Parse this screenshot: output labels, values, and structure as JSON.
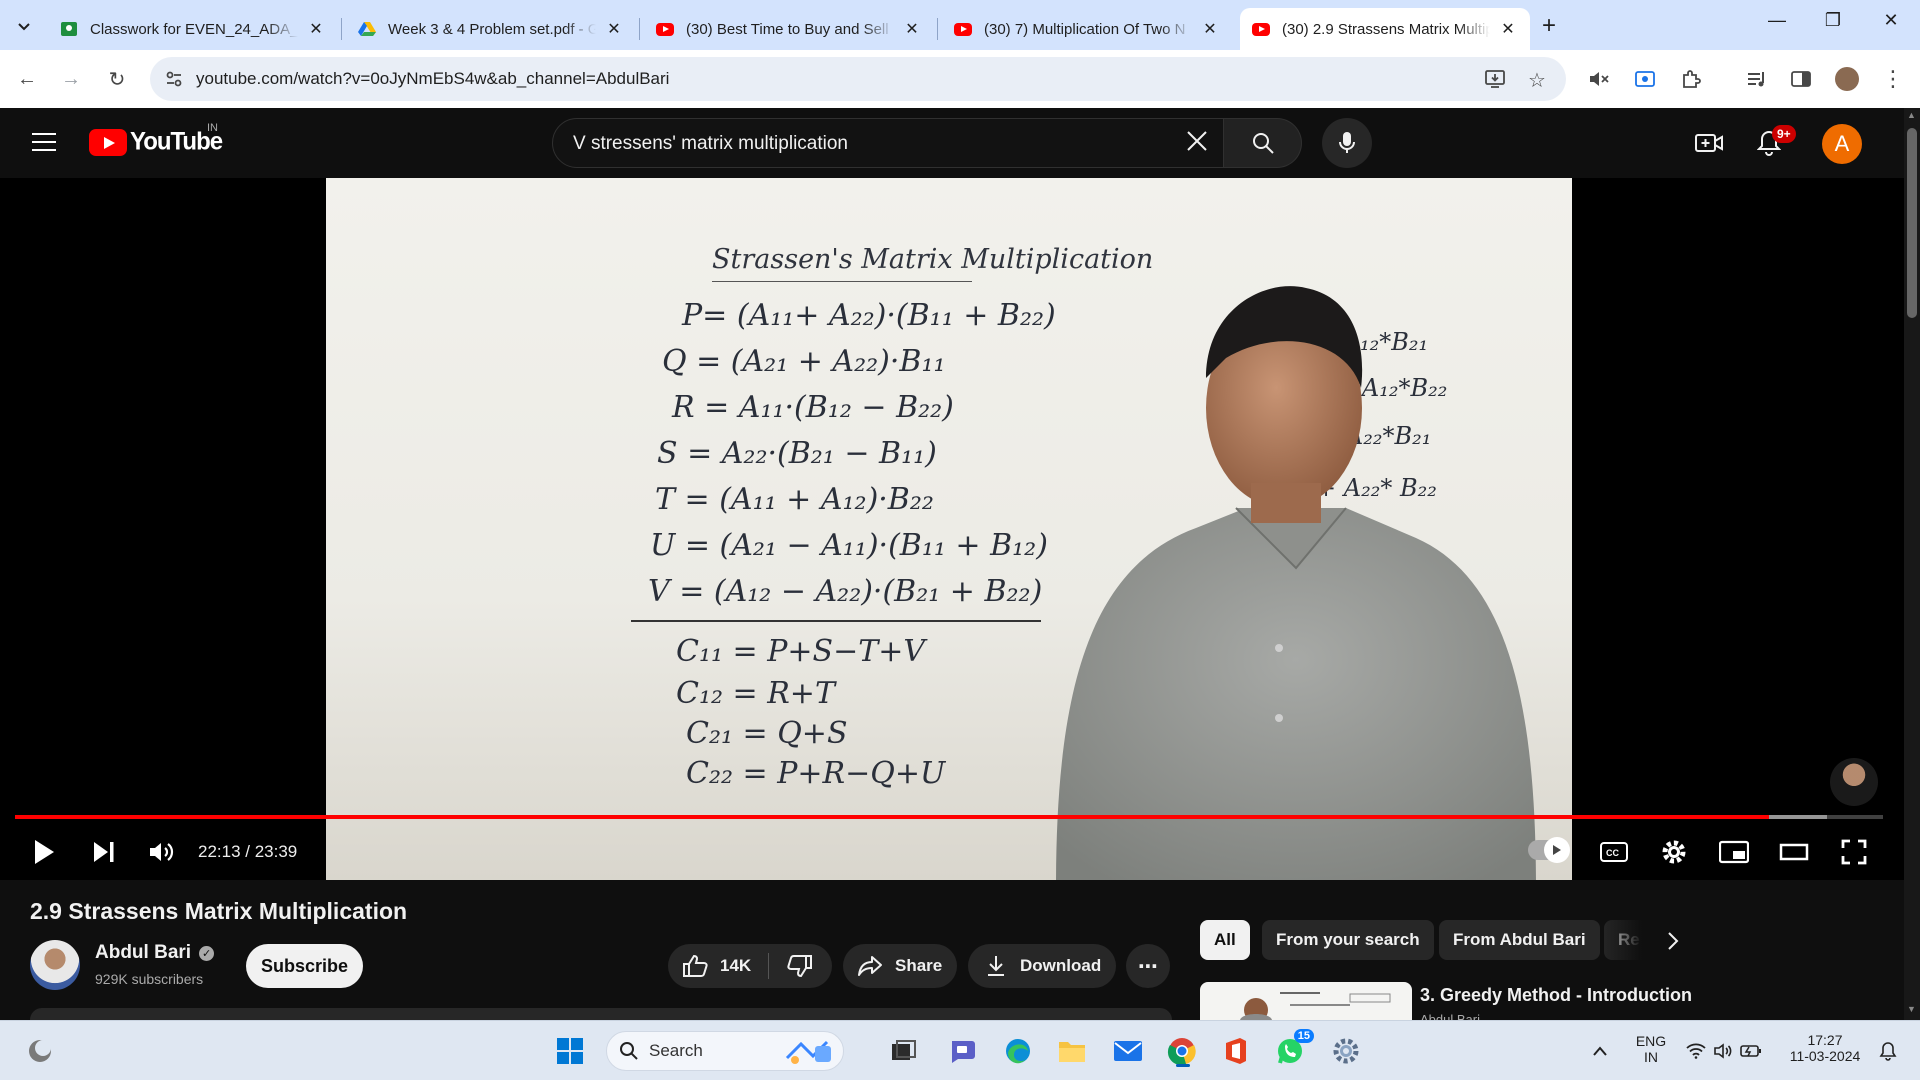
{
  "browser": {
    "tabs": [
      {
        "title": "Classwork for EVEN_24_ADA_AF",
        "favicon": "classroom-icon",
        "active": false
      },
      {
        "title": "Week 3 & 4 Problem set.pdf - G",
        "favicon": "drive-icon",
        "active": false
      },
      {
        "title": "(30) Best Time to Buy and Sell S",
        "favicon": "youtube-icon",
        "active": false
      },
      {
        "title": "(30) 7) Multiplication Of Two N",
        "favicon": "youtube-icon",
        "active": false
      },
      {
        "title": "(30) 2.9 Strassens Matrix Multip",
        "favicon": "youtube-icon",
        "active": true
      }
    ],
    "new_tab": "+",
    "url": "youtube.com/watch?v=0oJyNmEbS4w&ab_channel=AbdulBari"
  },
  "youtube": {
    "logo_text": "YouTube",
    "country": "IN",
    "search_query": "V stressens'  matrix multiplication",
    "notifications_badge": "9+",
    "account_initial": "A"
  },
  "player": {
    "time": "22:13 / 23:39",
    "progress_fraction": 0.939,
    "buffered_fraction": 0.97,
    "board": {
      "title": "Strassen's  Matrix Multiplication",
      "lines": [
        "P= (A₁₁+ A₂₂)·(B₁₁ + B₂₂)",
        "Q = (A₂₁ + A₂₂)·B₁₁",
        "R = A₁₁·(B₁₂ − B₂₂)",
        "S = A₂₂·(B₂₁ − B₁₁)",
        "T = (A₁₁ + A₁₂)·B₂₂",
        "U = (A₂₁ − A₁₁)·(B₁₁ + B₁₂)",
        "V = (A₁₂ − A₂₂)·(B₂₁ + B₂₂)"
      ],
      "results": [
        "C₁₁ = P+S−T+V",
        "C₁₂ = R+T",
        "C₂₁ = Q+S",
        "C₂₂ = P+R−Q+U"
      ],
      "right_fragments": [
        "* B₁₁+A₁₂*B₂₁",
        "* B₁₂ + A₁₂*B₂₂",
        "* B₁₁ + A₂₂*B₂₁",
        "+ A₂₂* B₂₂"
      ]
    }
  },
  "video": {
    "title": "2.9 Strassens Matrix Multiplication",
    "channel": "Abdul Bari",
    "subscribers": "929K subscribers",
    "subscribe_label": "Subscribe",
    "likes": "14K",
    "share_label": "Share",
    "download_label": "Download",
    "more_label": "⋯"
  },
  "sidebar": {
    "chips": [
      "All",
      "From your search",
      "From Abdul Bari",
      "Re"
    ],
    "first_rec_title": "3. Greedy Method - Introduction",
    "first_rec_channel": "Abdul Bari"
  },
  "taskbar": {
    "search_label": "Search",
    "whatsapp_badge": "15",
    "lang_top": "ENG",
    "lang_bottom": "IN",
    "clock_time": "17:27",
    "clock_date": "11-03-2024"
  }
}
